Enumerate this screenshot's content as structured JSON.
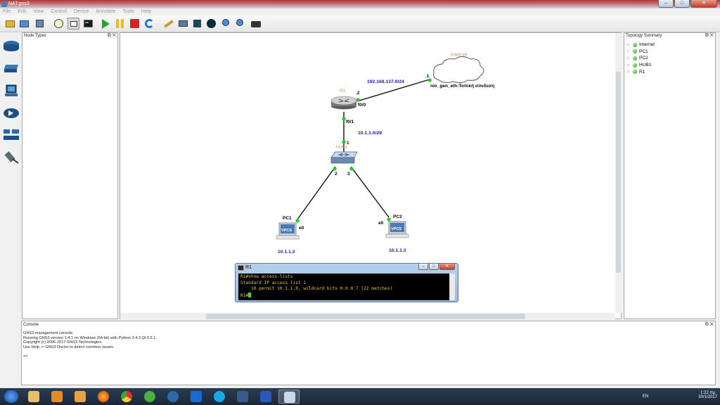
{
  "window": {
    "title": "NAT.gns3",
    "min": "–",
    "max": "□",
    "close": "✕"
  },
  "menu": [
    "File",
    "Edit",
    "View",
    "Control",
    "Device",
    "Annotate",
    "Tools",
    "Help"
  ],
  "toolbar_icons": [
    "new-project-icon",
    "open-folder-icon",
    "save-icon",
    "snapshot-clock-icon",
    "show-interface-labels-icon",
    "console-all-icon",
    "start-all-icon",
    "suspend-all-icon",
    "stop-all-icon",
    "reload-all-icon",
    "add-note-icon",
    "insert-picture-icon",
    "draw-rectangle-icon",
    "draw-ellipse-icon",
    "zoom-in-icon",
    "zoom-out-icon",
    "screenshot-icon"
  ],
  "node_types": {
    "title": "Node Types",
    "device_icons": [
      "router-icon",
      "switch-icon",
      "end-device-icon",
      "security-device-icon",
      "all-devices-icon",
      "link-cable-icon"
    ]
  },
  "topology_summary": {
    "title": "Topology Summary",
    "items": [
      "Internet",
      "PC1",
      "PC2",
      "HUB1",
      "R1"
    ]
  },
  "canvas": {
    "nodes": {
      "internet_label": "Internet",
      "r1_label": "R1",
      "hub_label": "HUB1",
      "pc1_label": "PC1",
      "pc2_label": "PC2",
      "vpcs_text": "VPCS"
    },
    "ports": {
      "cloud_port": ".1",
      "r1_wan_port": ".2",
      "r1_f00": "f0/0",
      "r1_f01": "f0/1",
      "hub_p1": "1",
      "hub_p2": "2",
      "hub_p3": "3",
      "pc1_port": "e0",
      "pc2_port": "e0",
      "nio": "nio_gen_eth:Τοπική σύνδεση"
    },
    "network_labels": {
      "wan": "192.168.137.0/24",
      "lan": "10.1.1.0/29",
      "pc1_ip": "10.1.1.2",
      "pc2_ip": "10.1.1.3"
    },
    "colors": {
      "link_ok": "#22cc22",
      "net_label": "#1a1aa8",
      "node_label": "#c8a040"
    }
  },
  "terminal": {
    "title": "R1",
    "lines": [
      "R1#show access-lists",
      "Standard IP access list 1",
      "    10 permit 10.1.1.0, wildcard bits 0.0.0.7 (22 matches)"
    ],
    "prompt": "R1#"
  },
  "console": {
    "title": "Console",
    "lines": [
      "GNS3 management console.",
      "Running GNS3 version 1.4.1 on Windows (64-bit) with Python 3.4.3 Qt 5.5.1.",
      "Copyright (c) 2006-2017 GNS3 Technologies.",
      "Use Help -> GNS3 Doctor to detect common issues.",
      "",
      "=>"
    ]
  },
  "taskbar": {
    "apps": [
      "windows-explorer-icon",
      "outlook-icon",
      "media-player-icon",
      "firefox-icon",
      "chrome-icon",
      "utorrent-icon",
      "gns3-globe-icon",
      "teamviewer-icon",
      "skype-icon",
      "app-icon",
      "word-icon",
      "gns3-icon"
    ],
    "lang": "EN",
    "time": "1:22 πμ",
    "date": "30/1/2017"
  },
  "dock_ctrls": "⧉ ✕"
}
